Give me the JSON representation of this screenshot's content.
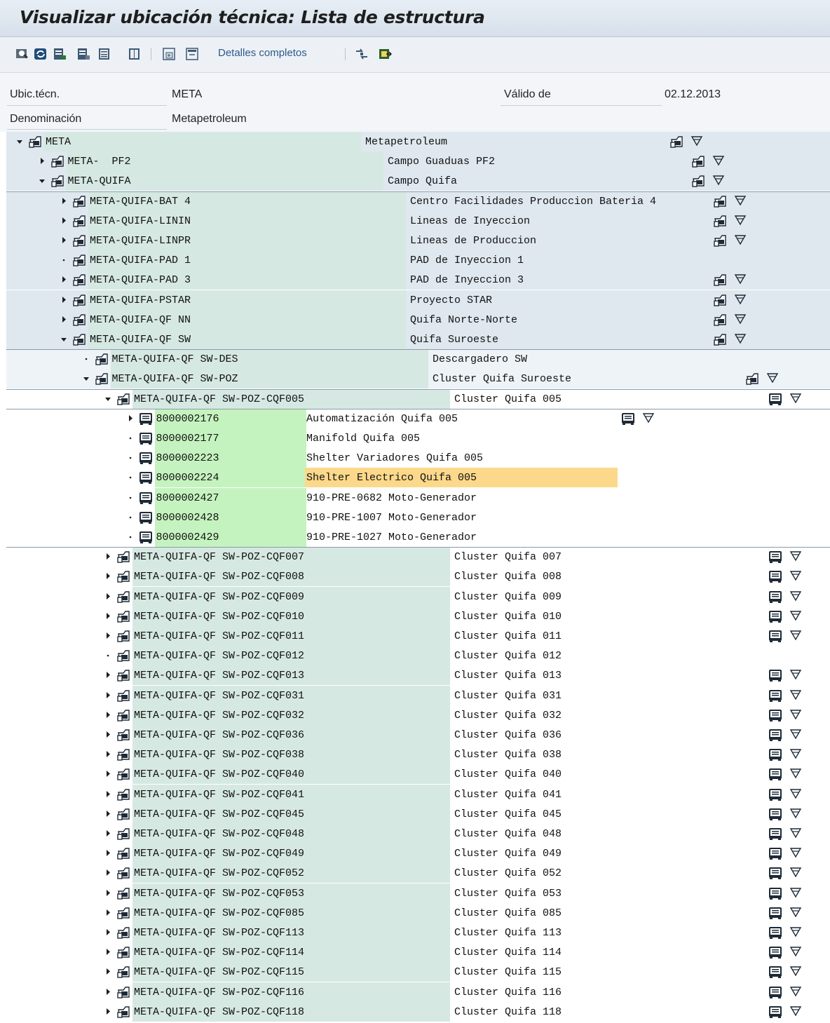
{
  "window": {
    "title": "Visualizar ubicación técnica: Lista de estructura"
  },
  "toolbar": {
    "detalles_label": "Detalles completos",
    "icons": [
      "display-icon",
      "refresh-icon",
      "expand-icon",
      "collapse-icon",
      "list-icon",
      "expand-all-icon",
      "collapse-all-icon",
      "navigate-icon",
      "export-icon"
    ]
  },
  "header": {
    "ubic_label": "Ubic.técn.",
    "ubic_value": "META",
    "valido_label": "Válido de",
    "valido_value": "02.12.2013",
    "denom_label": "Denominación",
    "denom_value": "Metapetroleum"
  },
  "colors": {
    "hierarchy_bg": "#dfe8ef",
    "key_teal": "#d6e8e2",
    "key_green": "#c5f3bf",
    "selected": "#fcd98a"
  },
  "tree": [
    {
      "level": 0,
      "expander": "expanded",
      "node_icon": "floc",
      "key": "META",
      "desc": "Metapetroleum",
      "right_icons": true,
      "right_icon_type": "floc"
    },
    {
      "level": 1,
      "expander": "collapsed",
      "node_icon": "floc",
      "key": "META-  PF2",
      "desc": "Campo Guaduas PF2",
      "right_icons": true,
      "right_icon_type": "floc"
    },
    {
      "level": 1,
      "expander": "expanded",
      "node_icon": "floc",
      "key": "META-QUIFA",
      "desc": "Campo Quifa",
      "right_icons": true,
      "right_icon_type": "floc"
    },
    {
      "level": 2,
      "expander": "collapsed",
      "node_icon": "floc",
      "key": "META-QUIFA-BAT 4",
      "desc": "Centro Facilidades Produccion Bateria 4",
      "right_icons": true,
      "right_icon_type": "floc"
    },
    {
      "level": 2,
      "expander": "collapsed",
      "node_icon": "floc",
      "key": "META-QUIFA-LININ",
      "desc": "Lineas de Inyeccion",
      "right_icons": true,
      "right_icon_type": "floc"
    },
    {
      "level": 2,
      "expander": "collapsed",
      "node_icon": "floc",
      "key": "META-QUIFA-LINPR",
      "desc": "Lineas de Produccion",
      "right_icons": true,
      "right_icon_type": "floc"
    },
    {
      "level": 2,
      "expander": "leaf",
      "node_icon": "floc",
      "key": "META-QUIFA-PAD 1",
      "desc": "PAD de Inyeccion 1",
      "right_icons": false
    },
    {
      "level": 2,
      "expander": "collapsed",
      "node_icon": "floc",
      "key": "META-QUIFA-PAD 3",
      "desc": "PAD de Inyeccion 3",
      "right_icons": true,
      "right_icon_type": "floc"
    },
    {
      "level": 2,
      "expander": "collapsed",
      "node_icon": "floc",
      "key": "META-QUIFA-PSTAR",
      "desc": "Proyecto STAR",
      "right_icons": true,
      "right_icon_type": "floc"
    },
    {
      "level": 2,
      "expander": "collapsed",
      "node_icon": "floc",
      "key": "META-QUIFA-QF NN",
      "desc": "Quifa Norte-Norte",
      "right_icons": true,
      "right_icon_type": "floc"
    },
    {
      "level": 2,
      "expander": "expanded",
      "node_icon": "floc",
      "key": "META-QUIFA-QF SW",
      "desc": "Quifa Suroeste",
      "right_icons": true,
      "right_icon_type": "floc"
    },
    {
      "level": 3,
      "expander": "leaf",
      "node_icon": "floc",
      "key": "META-QUIFA-QF SW-DES",
      "desc": "Descargadero SW",
      "right_icons": false
    },
    {
      "level": 3,
      "expander": "expanded",
      "node_icon": "floc",
      "key": "META-QUIFA-QF SW-POZ",
      "desc": "Cluster Quifa Suroeste",
      "right_icons": true,
      "right_icon_type": "floc"
    },
    {
      "level": 4,
      "expander": "expanded",
      "node_icon": "floc",
      "key": "META-QUIFA-QF SW-POZ-CQF005",
      "desc": "Cluster Quifa 005",
      "right_icons": true,
      "right_icon_type": "equip"
    },
    {
      "level": 5,
      "expander": "collapsed",
      "node_icon": "equip",
      "key": "8000002176",
      "desc": "Automatización Quifa 005",
      "right_icons": true,
      "right_icon_type": "equip"
    },
    {
      "level": 5,
      "expander": "leaf",
      "node_icon": "equip",
      "key": "8000002177",
      "desc": "Manifold Quifa 005",
      "right_icons": false
    },
    {
      "level": 5,
      "expander": "leaf",
      "node_icon": "equip",
      "key": "8000002223",
      "desc": "Shelter Variadores Quifa 005",
      "right_icons": false
    },
    {
      "level": 5,
      "expander": "leaf",
      "node_icon": "equip",
      "key": "8000002224",
      "desc": "Shelter Electrico Quifa 005",
      "right_icons": false,
      "selected": true
    },
    {
      "level": 5,
      "expander": "leaf",
      "node_icon": "equip",
      "key": "8000002427",
      "desc": "910-PRE-0682 Moto-Generador",
      "right_icons": false
    },
    {
      "level": 5,
      "expander": "leaf",
      "node_icon": "equip",
      "key": "8000002428",
      "desc": "910-PRE-1007 Moto-Generador",
      "right_icons": false
    },
    {
      "level": 5,
      "expander": "leaf",
      "node_icon": "equip",
      "key": "8000002429",
      "desc": "910-PRE-1027 Moto-Generador",
      "right_icons": false
    },
    {
      "level": 4,
      "expander": "collapsed",
      "node_icon": "floc",
      "key": "META-QUIFA-QF SW-POZ-CQF007",
      "desc": "Cluster Quifa 007",
      "right_icons": true,
      "right_icon_type": "equip"
    },
    {
      "level": 4,
      "expander": "collapsed",
      "node_icon": "floc",
      "key": "META-QUIFA-QF SW-POZ-CQF008",
      "desc": "Cluster Quifa 008",
      "right_icons": true,
      "right_icon_type": "equip"
    },
    {
      "level": 4,
      "expander": "collapsed",
      "node_icon": "floc",
      "key": "META-QUIFA-QF SW-POZ-CQF009",
      "desc": "Cluster Quifa 009",
      "right_icons": true,
      "right_icon_type": "equip"
    },
    {
      "level": 4,
      "expander": "collapsed",
      "node_icon": "floc",
      "key": "META-QUIFA-QF SW-POZ-CQF010",
      "desc": "Cluster Quifa 010",
      "right_icons": true,
      "right_icon_type": "equip"
    },
    {
      "level": 4,
      "expander": "collapsed",
      "node_icon": "floc",
      "key": "META-QUIFA-QF SW-POZ-CQF011",
      "desc": "Cluster Quifa 011",
      "right_icons": true,
      "right_icon_type": "equip"
    },
    {
      "level": 4,
      "expander": "leaf",
      "node_icon": "floc",
      "key": "META-QUIFA-QF SW-POZ-CQF012",
      "desc": "Cluster Quifa 012",
      "right_icons": false
    },
    {
      "level": 4,
      "expander": "collapsed",
      "node_icon": "floc",
      "key": "META-QUIFA-QF SW-POZ-CQF013",
      "desc": "Cluster Quifa 013",
      "right_icons": true,
      "right_icon_type": "equip"
    },
    {
      "level": 4,
      "expander": "collapsed",
      "node_icon": "floc",
      "key": "META-QUIFA-QF SW-POZ-CQF031",
      "desc": "Cluster Quifa 031",
      "right_icons": true,
      "right_icon_type": "equip"
    },
    {
      "level": 4,
      "expander": "collapsed",
      "node_icon": "floc",
      "key": "META-QUIFA-QF SW-POZ-CQF032",
      "desc": "Cluster Quifa 032",
      "right_icons": true,
      "right_icon_type": "equip"
    },
    {
      "level": 4,
      "expander": "collapsed",
      "node_icon": "floc",
      "key": "META-QUIFA-QF SW-POZ-CQF036",
      "desc": "Cluster Quifa 036",
      "right_icons": true,
      "right_icon_type": "equip"
    },
    {
      "level": 4,
      "expander": "collapsed",
      "node_icon": "floc",
      "key": "META-QUIFA-QF SW-POZ-CQF038",
      "desc": "Cluster Quifa 038",
      "right_icons": true,
      "right_icon_type": "equip"
    },
    {
      "level": 4,
      "expander": "collapsed",
      "node_icon": "floc",
      "key": "META-QUIFA-QF SW-POZ-CQF040",
      "desc": "Cluster Quifa 040",
      "right_icons": true,
      "right_icon_type": "equip"
    },
    {
      "level": 4,
      "expander": "collapsed",
      "node_icon": "floc",
      "key": "META-QUIFA-QF SW-POZ-CQF041",
      "desc": "Cluster Quifa 041",
      "right_icons": true,
      "right_icon_type": "equip"
    },
    {
      "level": 4,
      "expander": "collapsed",
      "node_icon": "floc",
      "key": "META-QUIFA-QF SW-POZ-CQF045",
      "desc": "Cluster Quifa 045",
      "right_icons": true,
      "right_icon_type": "equip"
    },
    {
      "level": 4,
      "expander": "collapsed",
      "node_icon": "floc",
      "key": "META-QUIFA-QF SW-POZ-CQF048",
      "desc": "Cluster Quifa 048",
      "right_icons": true,
      "right_icon_type": "equip"
    },
    {
      "level": 4,
      "expander": "collapsed",
      "node_icon": "floc",
      "key": "META-QUIFA-QF SW-POZ-CQF049",
      "desc": "Cluster Quifa 049",
      "right_icons": true,
      "right_icon_type": "equip"
    },
    {
      "level": 4,
      "expander": "collapsed",
      "node_icon": "floc",
      "key": "META-QUIFA-QF SW-POZ-CQF052",
      "desc": "Cluster Quifa 052",
      "right_icons": true,
      "right_icon_type": "equip"
    },
    {
      "level": 4,
      "expander": "collapsed",
      "node_icon": "floc",
      "key": "META-QUIFA-QF SW-POZ-CQF053",
      "desc": "Cluster Quifa 053",
      "right_icons": true,
      "right_icon_type": "equip"
    },
    {
      "level": 4,
      "expander": "collapsed",
      "node_icon": "floc",
      "key": "META-QUIFA-QF SW-POZ-CQF085",
      "desc": "Cluster Quifa 085",
      "right_icons": true,
      "right_icon_type": "equip"
    },
    {
      "level": 4,
      "expander": "collapsed",
      "node_icon": "floc",
      "key": "META-QUIFA-QF SW-POZ-CQF113",
      "desc": "Cluster Quifa 113",
      "right_icons": true,
      "right_icon_type": "equip"
    },
    {
      "level": 4,
      "expander": "collapsed",
      "node_icon": "floc",
      "key": "META-QUIFA-QF SW-POZ-CQF114",
      "desc": "Cluster Quifa 114",
      "right_icons": true,
      "right_icon_type": "equip"
    },
    {
      "level": 4,
      "expander": "collapsed",
      "node_icon": "floc",
      "key": "META-QUIFA-QF SW-POZ-CQF115",
      "desc": "Cluster Quifa 115",
      "right_icons": true,
      "right_icon_type": "equip"
    },
    {
      "level": 4,
      "expander": "collapsed",
      "node_icon": "floc",
      "key": "META-QUIFA-QF SW-POZ-CQF116",
      "desc": "Cluster Quifa 116",
      "right_icons": true,
      "right_icon_type": "equip"
    },
    {
      "level": 4,
      "expander": "collapsed",
      "node_icon": "floc",
      "key": "META-QUIFA-QF SW-POZ-CQF118",
      "desc": "Cluster Quifa 118",
      "right_icons": true,
      "right_icon_type": "equip"
    }
  ]
}
